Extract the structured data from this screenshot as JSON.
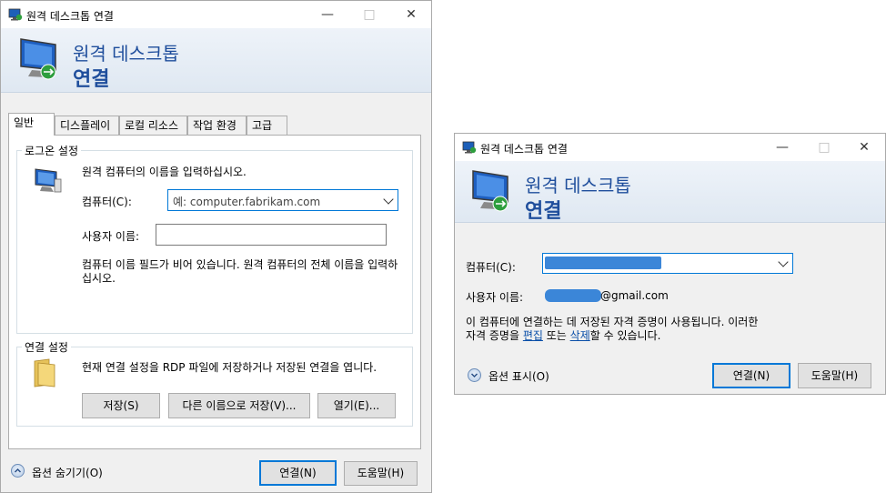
{
  "left_window": {
    "title": "원격 데스크톱 연결",
    "banner_line1": "원격 데스크톱",
    "banner_line2": "연결",
    "tabs": [
      "일반",
      "디스플레이",
      "로컬 리소스",
      "작업 환경",
      "고급"
    ],
    "logon_group": {
      "label": "로그온 설정",
      "instruction": "원격 컴퓨터의 이름을 입력하십시오.",
      "computer_label": "컴퓨터(C):",
      "computer_placeholder": "예: computer.fabrikam.com",
      "user_label": "사용자 이름:",
      "user_value": "",
      "warning": "컴퓨터 이름 필드가 비어 있습니다. 원격 컴퓨터의 전체 이름을 입력하십시오."
    },
    "connection_group": {
      "label": "연결 설정",
      "description": "현재 연결 설정을 RDP 파일에 저장하거나 저장된 연결을 엽니다.",
      "save_label": "저장(S)",
      "save_as_label": "다른 이름으로 저장(V)...",
      "open_label": "열기(E)..."
    },
    "options_toggle": "옵션 숨기기(O)",
    "connect_label": "연결(N)",
    "help_label": "도움말(H)"
  },
  "right_window": {
    "title": "원격 데스크톱 연결",
    "banner_line1": "원격 데스크톱",
    "banner_line2": "연결",
    "computer_label": "컴퓨터(C):",
    "user_label": "사용자 이름:",
    "user_suffix": "@gmail.com",
    "info_text_1": "이 컴퓨터에 연결하는 데 저장된 자격 증명이 사용됩니다. 이러한",
    "info_text_2_prefix": "자격 증명을 ",
    "edit_link": "편집",
    "info_text_2_mid": " 또는 ",
    "delete_link": "삭제",
    "info_text_2_suffix": "할 수 있습니다.",
    "options_toggle": "옵션 표시(O)",
    "connect_label": "연결(N)",
    "help_label": "도움말(H)"
  },
  "colors": {
    "accent": "#0078d7",
    "banner_text": "#1f4e9c",
    "redaction": "#3b86d8"
  }
}
